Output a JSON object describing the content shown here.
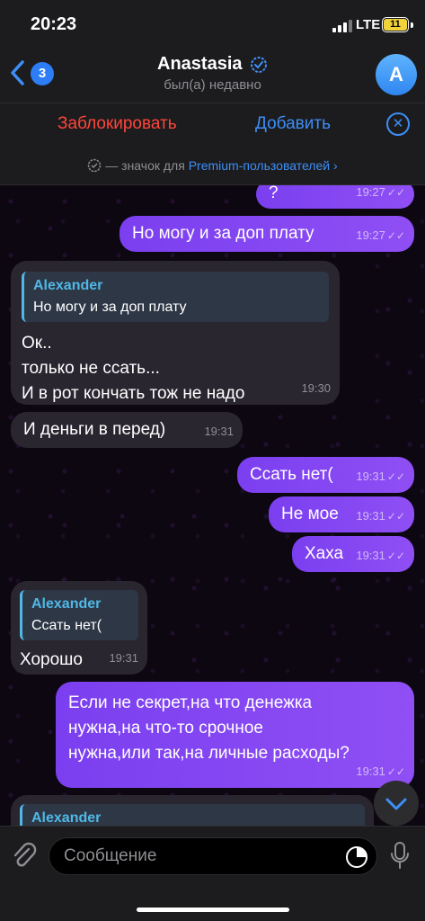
{
  "status_bar": {
    "time": "20:23",
    "network": "LTE",
    "battery": "11"
  },
  "header": {
    "unread_count": "3",
    "contact_name": "Anastasia",
    "last_seen": "был(а) недавно",
    "avatar_letter": "A"
  },
  "action_bar": {
    "block_label": "Заблокировать",
    "add_label": "Добавить"
  },
  "premium_note": {
    "prefix": "— значок для",
    "link": "Premium-пользователей",
    "chevron": "›"
  },
  "messages": [
    {
      "text": "?",
      "time": "19:27"
    },
    {
      "text": "Но могу и за доп плату",
      "time": "19:27"
    },
    {
      "reply_name": "Alexander",
      "reply_text": "Но могу и за доп плату",
      "text": "Ок..\nтолько не ссать...\nИ в рот кончать тож не надо",
      "time": "19:30"
    },
    {
      "text": "И деньги в перед)",
      "time": "19:31"
    },
    {
      "text": "Ссать нет(",
      "time": "19:31"
    },
    {
      "text": "Не мое",
      "time": "19:31"
    },
    {
      "text": "Хаха",
      "time": "19:31"
    },
    {
      "reply_name": "Alexander",
      "reply_text": "Ссать нет(",
      "text": "Хорошо",
      "time": "19:31"
    },
    {
      "text": "Если не секрет,на что денежка\nнужна,на что-то срочное\nнужна,или так,на личные расходы?",
      "time": "19:31"
    },
    {
      "reply_name": "Alexander"
    }
  ],
  "input": {
    "placeholder": "Сообщение"
  }
}
